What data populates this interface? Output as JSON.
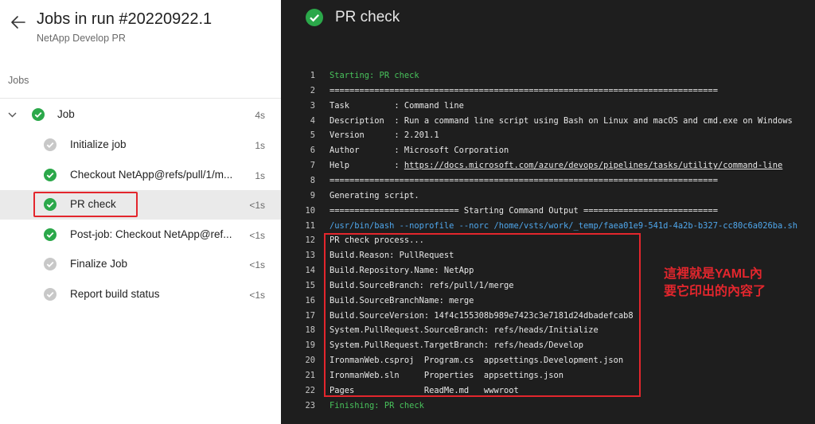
{
  "header": {
    "title": "Jobs in run #20220922.1",
    "subtitle": "NetApp Develop PR"
  },
  "jobs_label": "Jobs",
  "job": {
    "label": "Job",
    "duration": "4s"
  },
  "steps": [
    {
      "label": "Initialize job",
      "duration": "1s",
      "status": "skipped"
    },
    {
      "label": "Checkout NetApp@refs/pull/1/m...",
      "duration": "1s",
      "status": "success"
    },
    {
      "label": "PR check",
      "duration": "<1s",
      "status": "success",
      "selected": true
    },
    {
      "label": "Post-job: Checkout NetApp@ref...",
      "duration": "<1s",
      "status": "success"
    },
    {
      "label": "Finalize Job",
      "duration": "<1s",
      "status": "skipped"
    },
    {
      "label": "Report build status",
      "duration": "<1s",
      "status": "skipped"
    }
  ],
  "detail": {
    "title": "PR check",
    "log": [
      {
        "n": "1",
        "t": "Starting: PR check",
        "style": "green"
      },
      {
        "n": "2",
        "t": "=============================================================================="
      },
      {
        "n": "3",
        "t": "Task         : Command line"
      },
      {
        "n": "4",
        "t": "Description  : Run a command line script using Bash on Linux and macOS and cmd.exe on Windows"
      },
      {
        "n": "5",
        "t": "Version      : 2.201.1"
      },
      {
        "n": "6",
        "t": "Author       : Microsoft Corporation"
      },
      {
        "n": "7",
        "pre": "Help         : ",
        "link": "https://docs.microsoft.com/azure/devops/pipelines/tasks/utility/command-line"
      },
      {
        "n": "8",
        "t": "=============================================================================="
      },
      {
        "n": "9",
        "t": "Generating script."
      },
      {
        "n": "10",
        "t": "========================== Starting Command Output ==========================="
      },
      {
        "n": "11",
        "t": "/usr/bin/bash --noprofile --norc /home/vsts/work/_temp/faea01e9-541d-4a2b-b327-cc80c6a026ba.sh",
        "style": "cyan"
      },
      {
        "n": "12",
        "t": "PR check process..."
      },
      {
        "n": "13",
        "t": "Build.Reason: PullRequest"
      },
      {
        "n": "14",
        "t": "Build.Repository.Name: NetApp"
      },
      {
        "n": "15",
        "t": "Build.SourceBranch: refs/pull/1/merge"
      },
      {
        "n": "16",
        "t": "Build.SourceBranchName: merge"
      },
      {
        "n": "17",
        "t": "Build.SourceVersion: 14f4c155308b989e7423c3e7181d24dbadefcab8"
      },
      {
        "n": "18",
        "t": "System.PullRequest.SourceBranch: refs/heads/Initialize"
      },
      {
        "n": "19",
        "t": "System.PullRequest.TargetBranch: refs/heads/Develop"
      },
      {
        "n": "20",
        "t": "IronmanWeb.csproj  Program.cs  appsettings.Development.json"
      },
      {
        "n": "21",
        "t": "IronmanWeb.sln     Properties  appsettings.json"
      },
      {
        "n": "22",
        "t": "Pages              ReadMe.md   wwwroot"
      },
      {
        "n": "23",
        "t": "Finishing: PR check",
        "style": "green"
      }
    ],
    "annotation": "這裡就是YAML內\n要它印出的內容了"
  },
  "colors": {
    "success": "#2ba84a",
    "skipped": "#c8c8c8",
    "highlight": "#e3262d"
  }
}
